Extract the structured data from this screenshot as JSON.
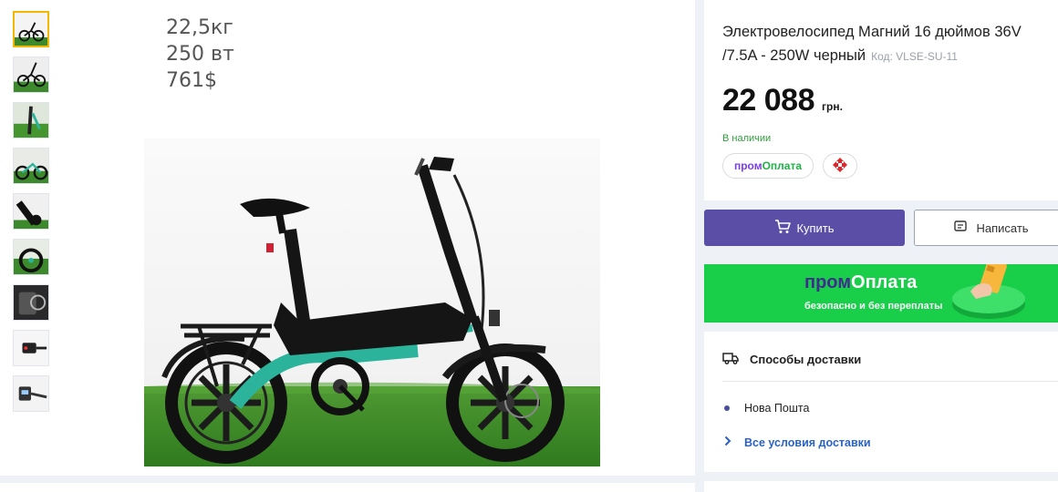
{
  "gallery": {
    "thumbnails": [
      {
        "alt": "thumb-1"
      },
      {
        "alt": "thumb-2"
      },
      {
        "alt": "thumb-3"
      },
      {
        "alt": "thumb-4"
      },
      {
        "alt": "thumb-5"
      },
      {
        "alt": "thumb-6"
      },
      {
        "alt": "thumb-7"
      },
      {
        "alt": "thumb-8"
      },
      {
        "alt": "thumb-9"
      }
    ],
    "active_index": 0,
    "specs": {
      "weight": "22,5кг",
      "power": "250 вт",
      "price_usd": "761$"
    }
  },
  "product": {
    "title": "Электровелосипед Магний 16 дюймов 36V /7.5A - 250W черный",
    "code": "Код: VLSE-SU-11",
    "price": "22 088",
    "currency": "грн.",
    "stock": "В наличии",
    "payment_badges": {
      "prom_part_a": "пром",
      "prom_part_b": "Оплата",
      "np_icon": "nova-poshta-icon"
    }
  },
  "actions": {
    "buy_label": "Купить",
    "write_label": "Написать"
  },
  "promo": {
    "title_a": "пром",
    "title_b": "Оплата",
    "subtitle": "безопасно и без переплаты"
  },
  "delivery": {
    "heading": "Способы доставки",
    "items": [
      "Нова Пошта"
    ],
    "link": "Все условия доставки"
  },
  "colors": {
    "buy_button": "#5b4ea6",
    "promo_banner": "#19cf49",
    "stock_green": "#2e9e3a",
    "link_blue": "#2a63c4",
    "thumb_active": "#f2b705"
  }
}
